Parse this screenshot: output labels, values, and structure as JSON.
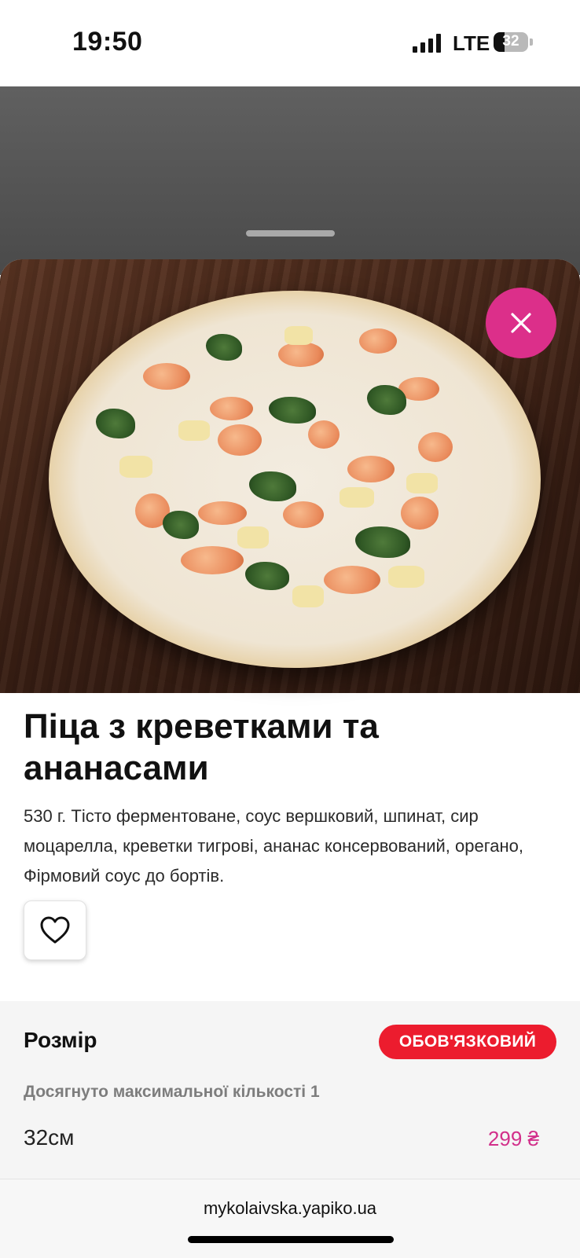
{
  "status_bar": {
    "time": "19:50",
    "network": "LTE",
    "battery": "32",
    "battery_level": 0.32
  },
  "product": {
    "title": "Піца з креветками та ананасами",
    "description": "530 г. Тісто ферментоване, соус вершковий, шпинат, сир моцарелла, креветки тигрові, ананас консервований, орегано, Фірмовий соус до бортів.",
    "image_icon": "pizza-photo",
    "close_icon": "close-icon",
    "favorite_icon": "heart-icon"
  },
  "options": {
    "title": "Розмір",
    "badge": "ОБОВ'ЯЗКОВИЙ",
    "limit_text": "Досягнуто максимальної кількості 1",
    "items": [
      {
        "label": "32см",
        "price": "299 ₴"
      }
    ]
  },
  "browser": {
    "url": "mykolaivska.yapiko.ua"
  },
  "colors": {
    "accent": "#dc2f8a",
    "badge": "#ec1c2e",
    "price": "#d22f8a"
  }
}
